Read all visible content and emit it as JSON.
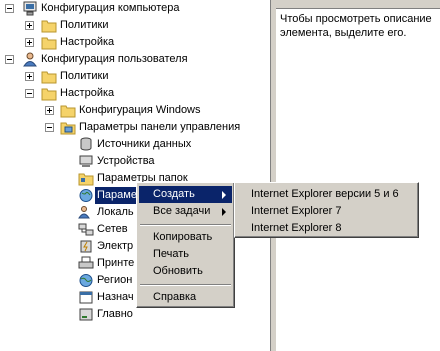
{
  "tree": {
    "computer_config": "Конфигурация компьютера",
    "policies_1": "Политики",
    "settings_1": "Настройка",
    "user_config": "Конфигурация пользователя",
    "policies_2": "Политики",
    "settings_2": "Настройка",
    "windows_config": "Конфигурация Windows",
    "control_panel": "Параметры панели управления",
    "data_sources": "Источники данных",
    "devices": "Устройства",
    "folder_options": "Параметры папок",
    "internet_settings": "Параметры обозревателя",
    "local_users": "Локаль",
    "network": "Сетев",
    "power": "Электр",
    "printers": "Принте",
    "regional": "Регион",
    "scheduled": "Назнач",
    "start_menu": "Главно"
  },
  "description": {
    "text": "Чтобы просмотреть описание элемента, выделите его."
  },
  "context_menu": {
    "create": "Создать",
    "all_tasks": "Все задачи",
    "copy": "Копировать",
    "print": "Печать",
    "refresh": "Обновить",
    "help": "Справка"
  },
  "submenu": {
    "ie56": "Internet Explorer версии 5 и 6",
    "ie7": "Internet Explorer 7",
    "ie8": "Internet Explorer 8"
  },
  "colors": {
    "highlight": "#0a246a",
    "menu_bg": "#d4d0c8",
    "folder": "#f5d36a"
  }
}
